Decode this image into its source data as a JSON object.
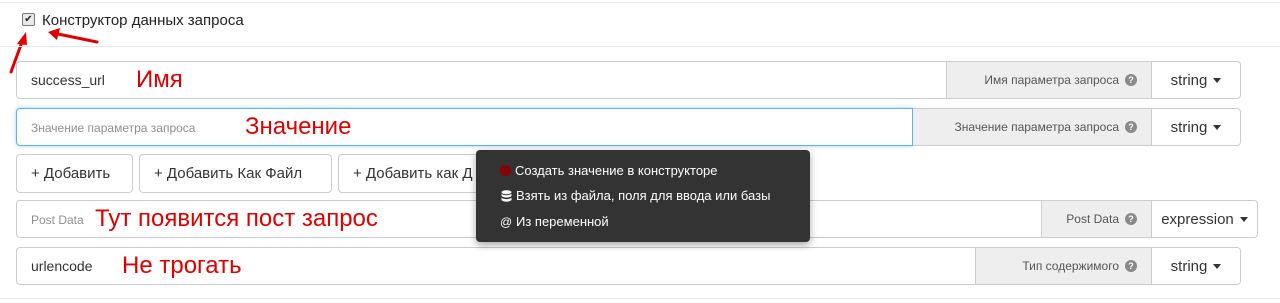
{
  "checkbox": {
    "label": "Конструктор данных запроса",
    "checked": true
  },
  "rows": {
    "name": {
      "value": "success_url",
      "addon": "Имя параметра запроса",
      "type": "string",
      "annotation": "Имя"
    },
    "value": {
      "placeholder": "Значение параметра запроса",
      "addon": "Значение параметра запроса",
      "type": "string",
      "annotation": "Значение"
    },
    "post": {
      "placeholder": "Post Data",
      "addon": "Post Data",
      "type": "expression",
      "annotation": "Тут появится пост запрос"
    },
    "content": {
      "value": "urlencode",
      "addon": "Тип содержимого",
      "type": "string",
      "annotation": "Не трогать"
    }
  },
  "buttons": {
    "add": "+ Добавить",
    "add_file": "+ Добавить Как Файл",
    "add_as": "+ Добавить как Д"
  },
  "menu": {
    "items": [
      {
        "label": "Создать значение в конструкторе",
        "icon": "record-icon"
      },
      {
        "label": "Взять из файла, поля для ввода или базы",
        "icon": "database-icon"
      },
      {
        "label": "Из переменной",
        "icon": "at-icon"
      }
    ]
  },
  "colors": {
    "annotation": "#e00000",
    "menu_bg": "#333333",
    "record_icon": "#8b0000",
    "focus": "#66afe9"
  }
}
